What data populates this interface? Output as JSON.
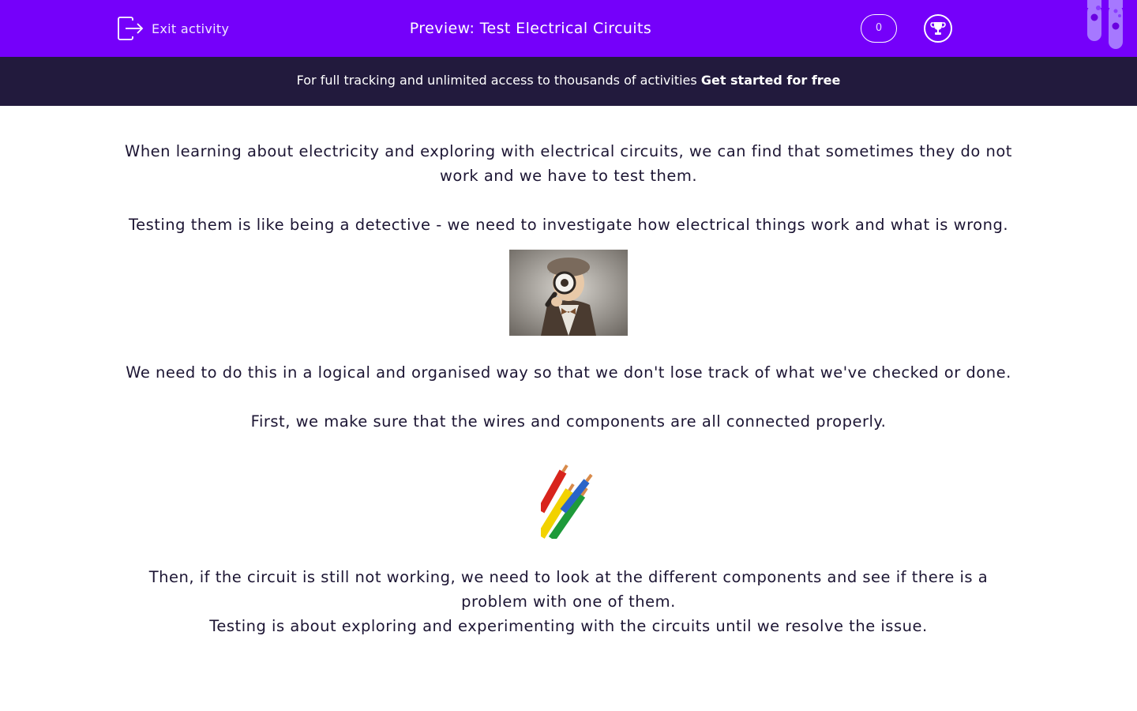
{
  "header": {
    "exit_label": "Exit activity",
    "title": "Preview: Test Electrical Circuits",
    "score": "0",
    "accent_color": "#7500fa"
  },
  "banner": {
    "text": "For full tracking and unlimited access to thousands of activities ",
    "cta": "Get started for free",
    "background": "#221a3d"
  },
  "content": {
    "para1": "When learning about electricity and exploring with electrical circuits, we can find that sometimes they do not work and we have to test them.",
    "para2": "Testing them is like being a detective - we need to investigate how electrical things work and what is wrong.",
    "para3": "We need to do this in a logical and organised way so that we don't lose track of what we've checked or done.",
    "para4": "First, we make sure that the wires and components are all connected properly.",
    "para5a": "Then, if the circuit is still not working, we need to look at the different components and see if there is a problem with one of them.",
    "para5b": "Testing is about exploring and experimenting with the circuits until we resolve the issue."
  },
  "icons": {
    "exit": "exit-icon",
    "trophy": "trophy-icon",
    "decoration": "test-tubes-icon"
  }
}
